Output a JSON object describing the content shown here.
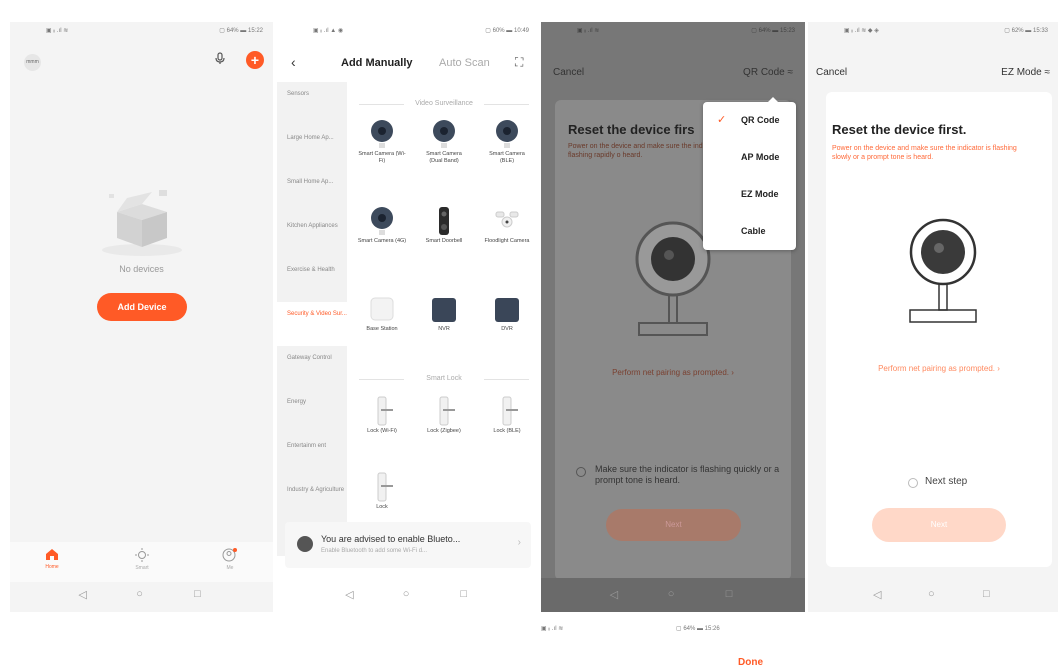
{
  "colors": {
    "accent": "#ff5a26"
  },
  "phone1": {
    "status_left": "▣ ᵢᵢ .ıl ≋",
    "status_right": "▢ 64% ▬ 15:22",
    "avatar_text": "mmm",
    "empty_text": "No devices",
    "add_button": "Add Device",
    "tabs": [
      {
        "label": "Home",
        "icon": "home-icon"
      },
      {
        "label": "Smart",
        "icon": "sun-icon"
      },
      {
        "label": "Me",
        "icon": "user-icon"
      }
    ]
  },
  "phone2": {
    "status_left": "▣ ᵢᵢ .ıl ▲ ◉",
    "status_right": "▢ 60% ▬ 10:49",
    "tab_manual": "Add Manually",
    "tab_auto": "Auto Scan",
    "categories": [
      "Sensors",
      "Large Home Ap...",
      "Small Home Ap...",
      "Kitchen Appliances",
      "Exercise & Health",
      "Security & Video Sur...",
      "Gateway Control",
      "Energy",
      "Entertainm ent",
      "Industry & Agriculture"
    ],
    "section_video": "Video Surveillance",
    "devices_video": [
      "Smart Camera (Wi-Fi)",
      "Smart Camera (Dual Band)",
      "Smart Camera (BLE)",
      "Smart Camera (4G)",
      "Smart Doorbell",
      "Floodlight Camera",
      "Base Station",
      "NVR",
      "DVR"
    ],
    "section_lock": "Smart Lock",
    "devices_lock": [
      "Lock (Wi-Fi)",
      "Lock (Zigbee)",
      "Lock (BLE)",
      "Lock"
    ],
    "bt_title": "You are advised to enable Blueto...",
    "bt_sub": "Enable Bluetooth to add some Wi-Fi d..."
  },
  "phone3": {
    "status_left": "▣ ᵢᵢ .ıl ≋",
    "status_right": "▢ 64% ▬ 15:23",
    "cancel": "Cancel",
    "mode": "QR Code ≈",
    "title": "Reset the device firs",
    "desc": "Power on the device and make sure the indicator is flashing rapidly o heard.",
    "perform": "Perform net pairing as prompted. ›",
    "check_text": "Make sure the indicator is flashing quickly or a prompt tone is heard.",
    "next_btn": "Next",
    "menu": [
      "QR Code",
      "AP Mode",
      "EZ Mode",
      "Cable"
    ]
  },
  "phone4": {
    "status_left": "▣ ᵢᵢ .ıl ≋ ◆ ◈",
    "status_right": "▢ 62% ▬ 15:33",
    "cancel": "Cancel",
    "mode": "EZ Mode ≈",
    "title": "Reset the device first.",
    "desc": "Power on the device and make sure the indicator is flashing slowly or a prompt tone is heard.",
    "perform": "Perform net pairing as prompted. ›",
    "next_step": "Next step",
    "next_btn": "Next"
  },
  "phone5": {
    "status_left": "▣ ᵢᵢ .ıl ≋",
    "status_right": "▢ 64% ▬ 15:26",
    "done": "Done"
  },
  "nav": {
    "back": "◁",
    "home": "○",
    "recent": "□"
  }
}
